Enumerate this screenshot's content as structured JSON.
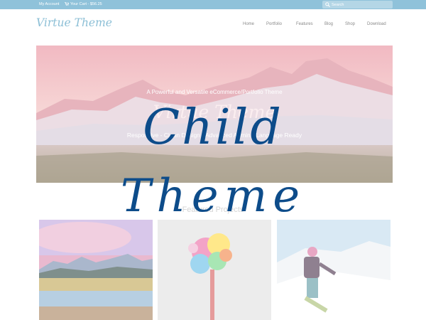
{
  "topbar": {
    "account_label": "My Account",
    "cart_label": "Your Cart - $56.25",
    "search_placeholder": "Search",
    "cart_icon": "cart-icon",
    "search_icon": "search-icon"
  },
  "header": {
    "logo": "Virtue Theme",
    "nav": [
      "Home",
      "Portfolio",
      "Features",
      "Blog",
      "Shop",
      "Download"
    ]
  },
  "hero": {
    "tagline": "A Powerful and Versatile eCommerce/Portfolio Theme",
    "title": "Virtue Theme",
    "subtitle": "Responsive - Clean Design - Advanced Admin - Language Ready"
  },
  "featured": {
    "heading": "Featured Projects"
  },
  "overlay": {
    "line1": "Child",
    "line2": "Theme"
  },
  "colors": {
    "topbar": "#8fc2da",
    "logo": "#8cbfd6",
    "overlay_text": "#0d4c8a"
  }
}
